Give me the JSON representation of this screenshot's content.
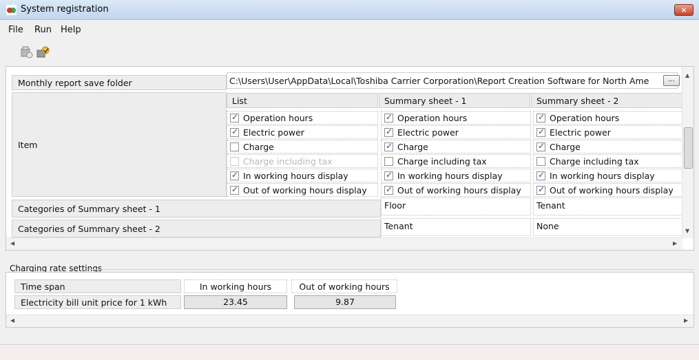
{
  "window": {
    "title": "System registration",
    "close_label": "×"
  },
  "menu": {
    "file": "File",
    "run": "Run",
    "help": "Help"
  },
  "toolbar": {
    "btn1_icon": "register-icon",
    "btn2_icon": "run-icon"
  },
  "report": {
    "save_folder_label": "Monthly report save folder",
    "save_folder_path": "C:\\Users\\User\\AppData\\Local\\Toshiba Carrier Corporation\\Report Creation Software for North Ame",
    "browse_label": "...",
    "item_label": "Item",
    "columns": [
      {
        "header": "List",
        "items": [
          {
            "label": "Operation hours",
            "checked": true,
            "enabled": true
          },
          {
            "label": "Electric power",
            "checked": true,
            "enabled": true
          },
          {
            "label": "Charge",
            "checked": false,
            "enabled": true
          },
          {
            "label": "Charge including tax",
            "checked": false,
            "enabled": false
          },
          {
            "label": "In working hours display",
            "checked": true,
            "enabled": true
          },
          {
            "label": "Out of working hours display",
            "checked": true,
            "enabled": true
          }
        ]
      },
      {
        "header": "Summary sheet - 1",
        "items": [
          {
            "label": "Operation hours",
            "checked": true,
            "enabled": true
          },
          {
            "label": "Electric power",
            "checked": true,
            "enabled": true
          },
          {
            "label": "Charge",
            "checked": true,
            "enabled": true
          },
          {
            "label": "Charge including tax",
            "checked": false,
            "enabled": true
          },
          {
            "label": "In working hours display",
            "checked": true,
            "enabled": true
          },
          {
            "label": "Out of working hours display",
            "checked": true,
            "enabled": true
          }
        ]
      },
      {
        "header": "Summary sheet - 2",
        "items": [
          {
            "label": "Operation hours",
            "checked": true,
            "enabled": true
          },
          {
            "label": "Electric power",
            "checked": true,
            "enabled": true
          },
          {
            "label": "Charge",
            "checked": true,
            "enabled": true
          },
          {
            "label": "Charge including tax",
            "checked": false,
            "enabled": true
          },
          {
            "label": "In working hours display",
            "checked": true,
            "enabled": true
          },
          {
            "label": "Out of working hours display",
            "checked": true,
            "enabled": true
          }
        ]
      }
    ],
    "categories1_label": "Categories of Summary sheet - 1",
    "categories2_label": "Categories of Summary sheet - 2",
    "categories1": {
      "sheet1": "Floor",
      "sheet2": "Tenant"
    },
    "categories2": {
      "sheet1": "Tenant",
      "sheet2": "None"
    }
  },
  "charging": {
    "group_label": "Charging rate settings",
    "time_span_label": "Time span",
    "unit_price_label": "Electricity bill unit price for 1 kWh",
    "in_hours_label": "In working hours",
    "out_hours_label": "Out of working hours",
    "in_hours_value": "23.45",
    "out_hours_value": "9.87"
  }
}
